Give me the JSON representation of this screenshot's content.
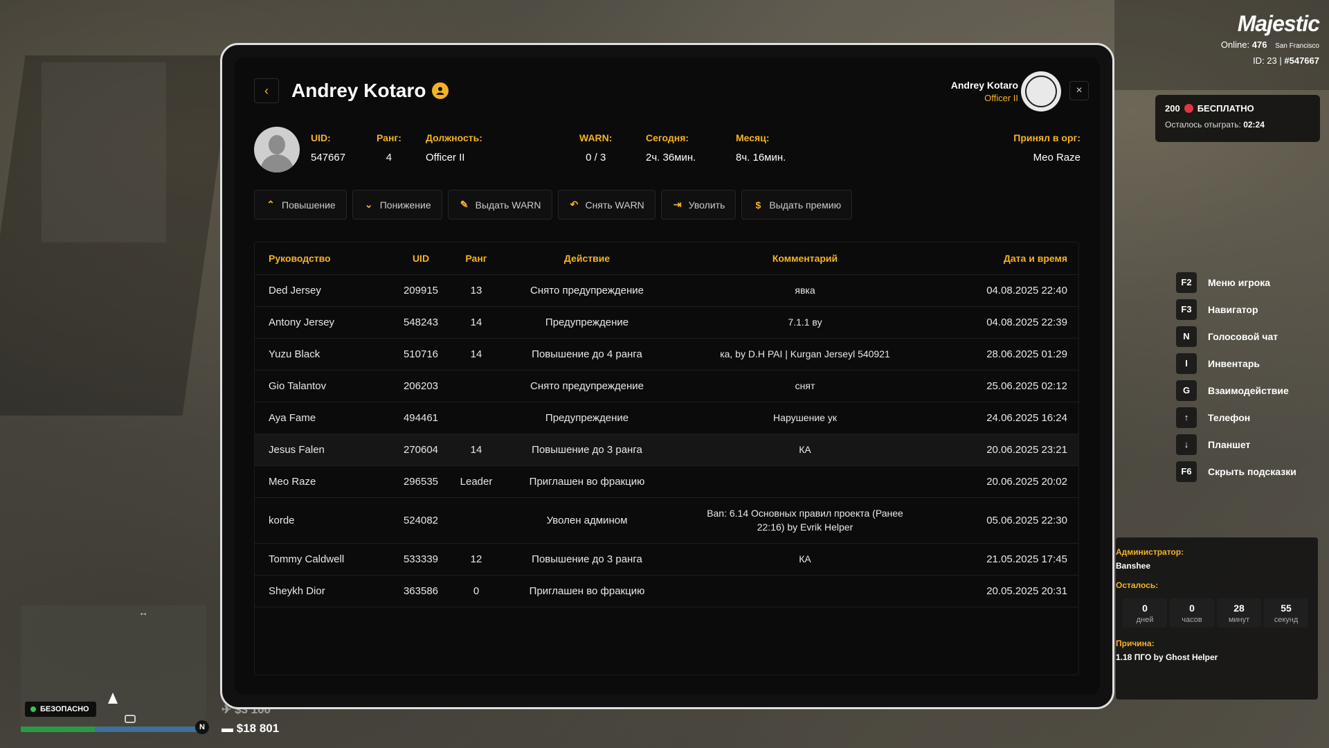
{
  "hud": {
    "brand": "Majestic",
    "online_label": "Online:",
    "online_count": "476",
    "city": "San Francisco",
    "id_text": "ID: 23 |",
    "id_number": "#547667",
    "bonus_amount": "200",
    "bonus_text": "БЕСПЛАТНО",
    "bonus_remaining_label": "Осталось отыграть:",
    "bonus_remaining_time": "02:24",
    "hotkeys": [
      {
        "key": "F2",
        "label": "Меню игрока"
      },
      {
        "key": "F3",
        "label": "Навигатор"
      },
      {
        "key": "N",
        "label": "Голосовой чат"
      },
      {
        "key": "I",
        "label": "Инвентарь"
      },
      {
        "key": "G",
        "label": "Взаимодействие"
      },
      {
        "key": "↑",
        "label": "Телефон"
      },
      {
        "key": "↓",
        "label": "Планшет"
      },
      {
        "key": "F6",
        "label": "Скрыть подсказки"
      }
    ],
    "admin": {
      "admin_label": "Администратор:",
      "admin_name": "Banshee",
      "remaining_label": "Осталось:",
      "timer": [
        {
          "value": "0",
          "unit": "дней"
        },
        {
          "value": "0",
          "unit": "часов"
        },
        {
          "value": "28",
          "unit": "минут"
        },
        {
          "value": "55",
          "unit": "секунд"
        }
      ],
      "reason_label": "Причина:",
      "reason": "1.18 ПГО by Ghost Helper"
    },
    "safe_zone": "БЕЗОПАСНО",
    "compass": "N",
    "health_fraction": 0.4,
    "armor_fraction": 0.55,
    "money_previous": "$3 100",
    "money": "$18 801"
  },
  "profile": {
    "name": "Andrey Kotaro",
    "viewer_name": "Andrey Kotaro",
    "viewer_rank": "Officer II",
    "close": "×",
    "back": "‹",
    "fields": [
      {
        "label": "UID:",
        "value": "547667"
      },
      {
        "label": "Ранг:",
        "value": "4"
      },
      {
        "label": "Должность:",
        "value": "Officer II"
      },
      {
        "label": "WARN:",
        "value": "0 / 3"
      },
      {
        "label": "Сегодня:",
        "value": "2ч. 36мин."
      },
      {
        "label": "Месяц:",
        "value": "8ч. 16мин."
      },
      {
        "label": "Принял в орг:",
        "value": "Meo Raze"
      }
    ],
    "actions": [
      {
        "label": "Повышение",
        "icon": "⌃"
      },
      {
        "label": "Понижение",
        "icon": "⌄"
      },
      {
        "label": "Выдать WARN",
        "icon": "✎"
      },
      {
        "label": "Снять WARN",
        "icon": "↶"
      },
      {
        "label": "Уволить",
        "icon": "⇥"
      },
      {
        "label": "Выдать премию",
        "icon": "$"
      }
    ]
  },
  "log": {
    "headers": [
      "Руководство",
      "UID",
      "Ранг",
      "Действие",
      "Комментарий",
      "Дата и время"
    ],
    "rows": [
      [
        "Ded Jersey",
        "209915",
        "13",
        "Снято предупреждение",
        "явка",
        "04.08.2025 22:40"
      ],
      [
        "Antony Jersey",
        "548243",
        "14",
        "Предупреждение",
        "7.1.1 ву",
        "04.08.2025 22:39"
      ],
      [
        "Yuzu Black",
        "510716",
        "14",
        "Повышение до 4 ранга",
        "ка, by D.H PAI | Kurgan Jerseyl 540921",
        "28.06.2025 01:29"
      ],
      [
        "Gio Talantov",
        "206203",
        "",
        "Снято предупреждение",
        "снят",
        "25.06.2025 02:12"
      ],
      [
        "Aya Fame",
        "494461",
        "",
        "Предупреждение",
        "Нарушение ук",
        "24.06.2025 16:24"
      ],
      [
        "Jesus Falen",
        "270604",
        "14",
        "Повышение до 3 ранга",
        "КА",
        "20.06.2025 23:21"
      ],
      [
        "Meo Raze",
        "296535",
        "Leader",
        "Приглашен во фракцию",
        "",
        "20.06.2025 20:02"
      ],
      [
        "korde",
        "524082",
        "",
        "Уволен админом",
        "Ban: 6.14 Основных правил проекта (Ранее 22:16) by Evrik Helper",
        "05.06.2025 22:30"
      ],
      [
        "Tommy Caldwell",
        "533339",
        "12",
        "Повышение до 3 ранга",
        "КА",
        "21.05.2025 17:45"
      ],
      [
        "Sheykh Dior",
        "363586",
        "0",
        "Приглашен во фракцию",
        "",
        "20.05.2025 20:31"
      ]
    ]
  }
}
